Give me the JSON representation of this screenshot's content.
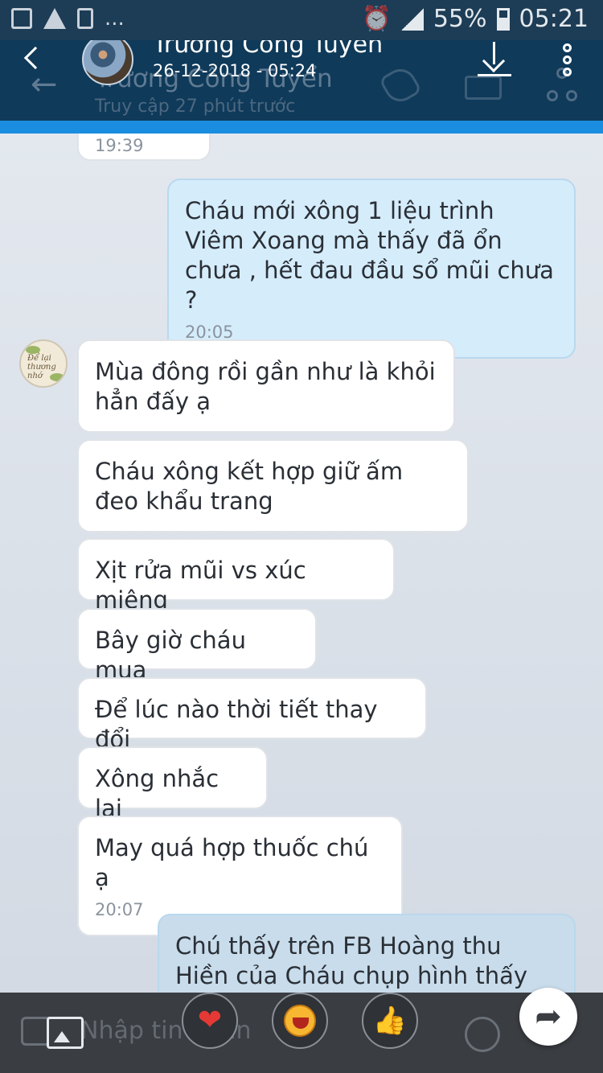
{
  "status_bar": {
    "left_more": "...",
    "battery_pct": "55%",
    "time": "05:21"
  },
  "viewer": {
    "back_glyph": "<",
    "title": "Trương Công Tuyển",
    "subtitle": "26-12-2018 - 05:24"
  },
  "chat_header": {
    "title": "Trương Công Tuyển",
    "subtitle": "Truy cập 27 phút trước"
  },
  "messages": [
    {
      "side": "in",
      "text": "",
      "time": "19:39"
    },
    {
      "side": "out",
      "text": "Cháu mới xông 1 liệu trình Viêm Xoang mà thấy đã ổn chưa , hết đau đầu sổ mũi chưa ?",
      "time": "20:05"
    },
    {
      "side": "in",
      "text": "Mùa đông rồi gần như là khỏi hẳn đấy ạ",
      "time": ""
    },
    {
      "side": "in",
      "text": "Cháu xông kết hợp giữ ấm đeo khẩu trang",
      "time": ""
    },
    {
      "side": "in",
      "text": "Xịt rửa mũi vs xúc miệng",
      "time": ""
    },
    {
      "side": "in",
      "text": "Bây giờ cháu mua",
      "time": ""
    },
    {
      "side": "in",
      "text": "Để lúc nào thời tiết thay đổi",
      "time": ""
    },
    {
      "side": "in",
      "text": "Xông nhắc lại",
      "time": ""
    },
    {
      "side": "in",
      "text": "May quá hợp thuốc chú ạ",
      "time": "20:07"
    },
    {
      "side": "out",
      "text": "Chú thấy trên FB Hoàng thu Hiền của Cháu chụp hình thấy đau",
      "time": ""
    }
  ],
  "contact_avatar_text": "Để lại thương nhớ",
  "composer": {
    "placeholder": "Nhập tin nhắn"
  },
  "reactions": [
    "heart",
    "laugh",
    "thumbs-up"
  ],
  "reaction_glyphs": {
    "heart": "❤",
    "thumb": "👍"
  },
  "share_glyph": "➦",
  "colors": {
    "header": "#0f3a5a",
    "accent": "#1b8de0",
    "outgoing_bubble": "#d5ecfb"
  }
}
